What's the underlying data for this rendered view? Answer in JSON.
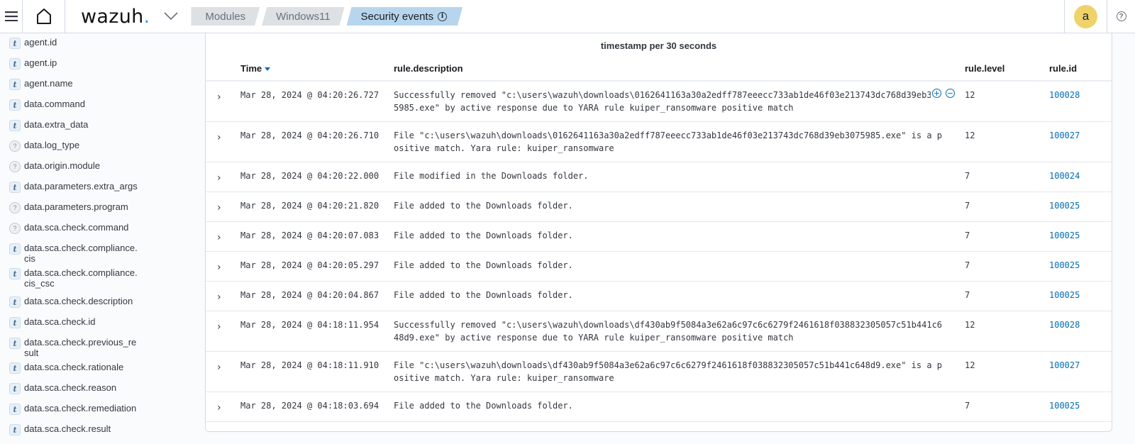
{
  "header": {
    "logo_text": "wazuh",
    "logo_dot": ".",
    "breadcrumbs": [
      {
        "label": "Modules"
      },
      {
        "label": "Windows11"
      },
      {
        "label": "Security events"
      }
    ],
    "avatar_letter": "a",
    "help_glyph": "?"
  },
  "sidebar": {
    "fields": [
      {
        "type": "t",
        "name": "agent.id"
      },
      {
        "type": "t",
        "name": "agent.ip"
      },
      {
        "type": "t",
        "name": "agent.name"
      },
      {
        "type": "t",
        "name": "data.command"
      },
      {
        "type": "t",
        "name": "data.extra_data"
      },
      {
        "type": "?",
        "name": "data.log_type"
      },
      {
        "type": "?",
        "name": "data.origin.module"
      },
      {
        "type": "t",
        "name": "data.parameters.extra_args"
      },
      {
        "type": "?",
        "name": "data.parameters.program"
      },
      {
        "type": "?",
        "name": "data.sca.check.command"
      },
      {
        "type": "t",
        "name": "data.sca.check.compliance.cis"
      },
      {
        "type": "t",
        "name": "data.sca.check.compliance.\ncis_csc"
      },
      {
        "type": "t",
        "name": "data.sca.check.description"
      },
      {
        "type": "t",
        "name": "data.sca.check.id"
      },
      {
        "type": "t",
        "name": "data.sca.check.previous_result"
      },
      {
        "type": "t",
        "name": "data.sca.check.rationale"
      },
      {
        "type": "t",
        "name": "data.sca.check.reason"
      },
      {
        "type": "t",
        "name": "data.sca.check.remediation"
      },
      {
        "type": "t",
        "name": "data.sca.check.result"
      }
    ]
  },
  "main": {
    "chart_title": "timestamp per 30 seconds",
    "columns": {
      "time": "Time",
      "description": "rule.description",
      "level": "rule.level",
      "id": "rule.id"
    },
    "rows": [
      {
        "time": "Mar 28, 2024 @ 04:20:26.727",
        "description": "Successfully removed \"c:\\users\\wazuh\\downloads\\0162641163a30a2edff787eeecc733ab1de46f03e213743dc768d39eb3075985.exe\" by active response due to YARA rule kuiper_ransomware positive match",
        "level": "12",
        "id": "100028"
      },
      {
        "time": "Mar 28, 2024 @ 04:20:26.710",
        "description": "File \"c:\\users\\wazuh\\downloads\\0162641163a30a2edff787eeecc733ab1de46f03e213743dc768d39eb3075985.exe\" is a positive match. Yara rule: kuiper_ransomware",
        "level": "12",
        "id": "100027"
      },
      {
        "time": "Mar 28, 2024 @ 04:20:22.000",
        "description": "File modified in the Downloads folder.",
        "level": "7",
        "id": "100024"
      },
      {
        "time": "Mar 28, 2024 @ 04:20:21.820",
        "description": "File added to the Downloads folder.",
        "level": "7",
        "id": "100025"
      },
      {
        "time": "Mar 28, 2024 @ 04:20:07.083",
        "description": "File added to the Downloads folder.",
        "level": "7",
        "id": "100025"
      },
      {
        "time": "Mar 28, 2024 @ 04:20:05.297",
        "description": "File added to the Downloads folder.",
        "level": "7",
        "id": "100025"
      },
      {
        "time": "Mar 28, 2024 @ 04:20:04.867",
        "description": "File added to the Downloads folder.",
        "level": "7",
        "id": "100025"
      },
      {
        "time": "Mar 28, 2024 @ 04:18:11.954",
        "description": "Successfully removed \"c:\\users\\wazuh\\downloads\\df430ab9f5084a3e62a6c97c6c6279f2461618f038832305057c51b441c648d9.exe\" by active response due to YARA rule kuiper_ransomware positive match",
        "level": "12",
        "id": "100028"
      },
      {
        "time": "Mar 28, 2024 @ 04:18:11.910",
        "description": "File \"c:\\users\\wazuh\\downloads\\df430ab9f5084a3e62a6c97c6c6279f2461618f038832305057c51b441c648d9.exe\" is a positive match. Yara rule: kuiper_ransomware",
        "level": "12",
        "id": "100027"
      },
      {
        "time": "Mar 28, 2024 @ 04:18:03.694",
        "description": "File added to the Downloads folder.",
        "level": "7",
        "id": "100025"
      }
    ],
    "filter_icons": {
      "add": "+",
      "remove": "−"
    }
  },
  "colors": {
    "accent": "#006bb4",
    "active_crumb": "#b7d6ee",
    "avatar": "#efd36a",
    "logo_dot": "#3595f9"
  }
}
